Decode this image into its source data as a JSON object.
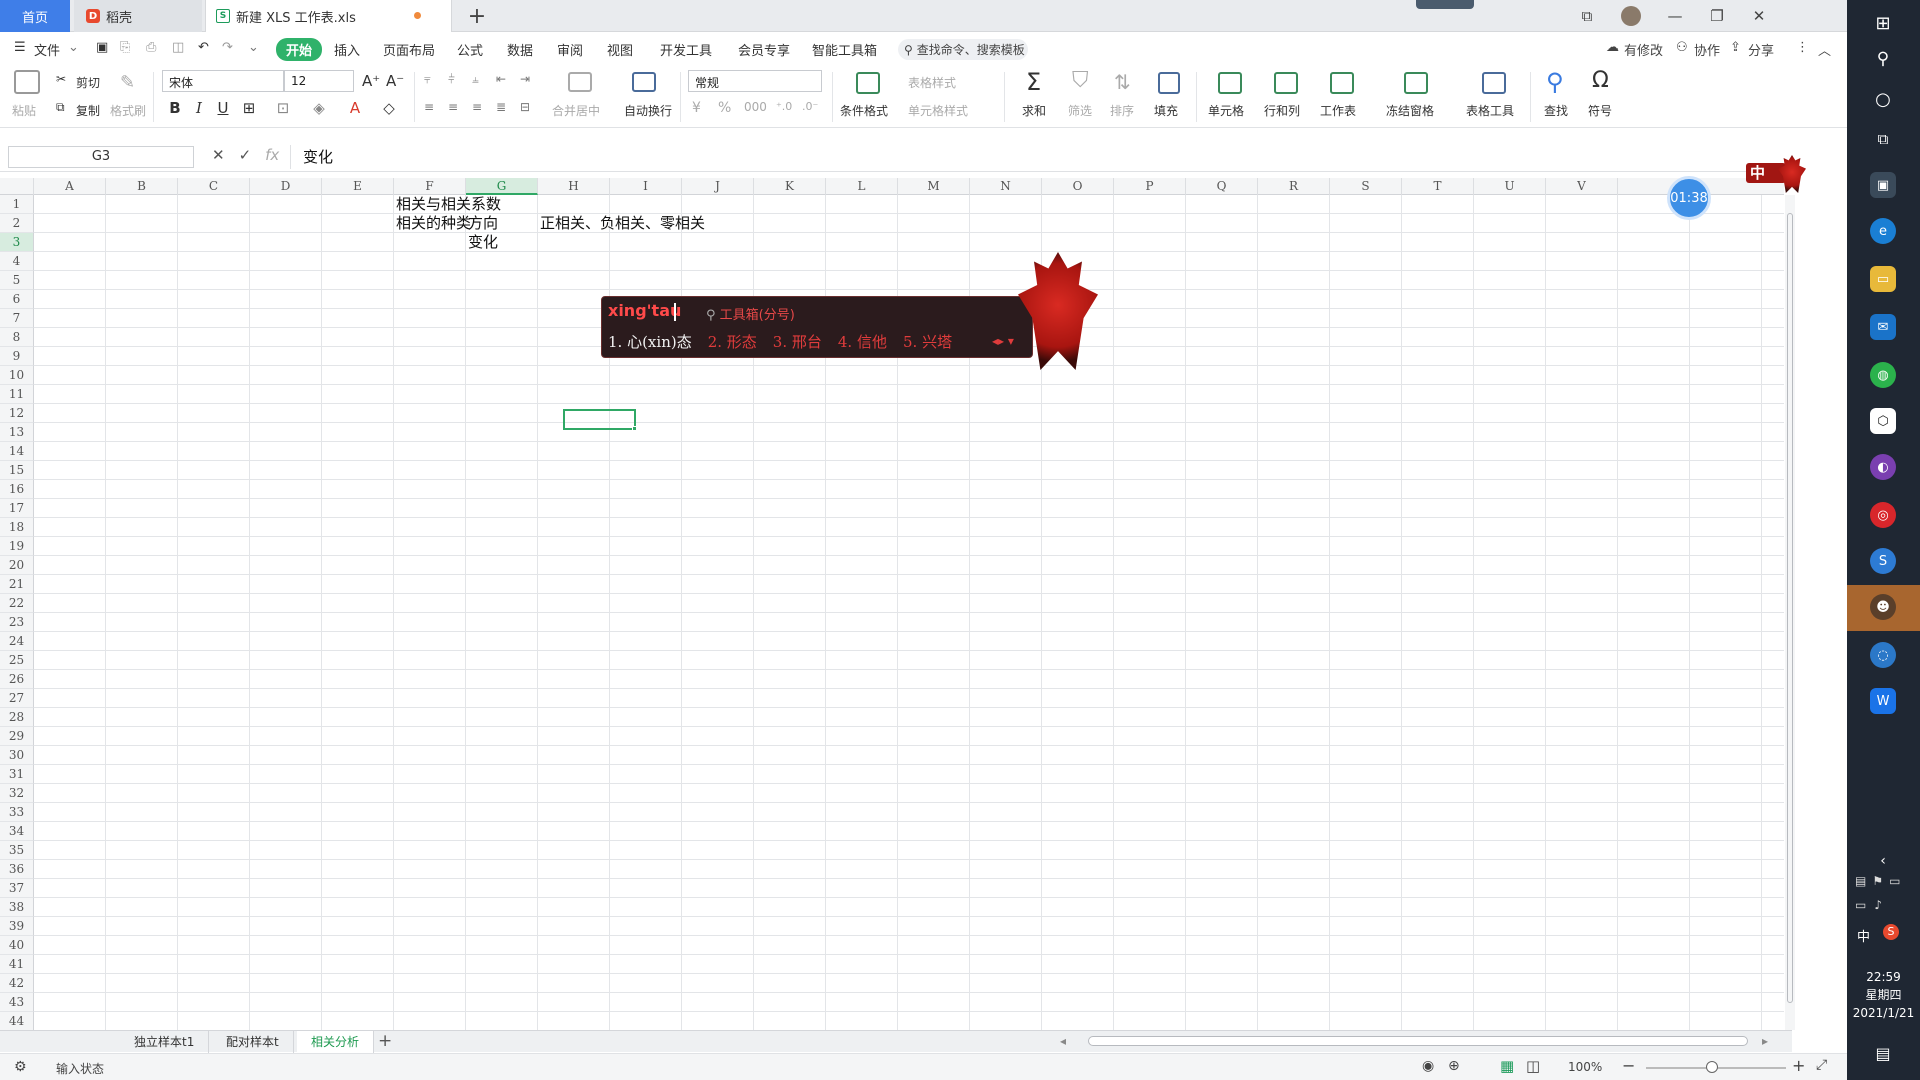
{
  "tabs": {
    "home": "首页",
    "docer": "稻壳",
    "doc_title": "新建 XLS 工作表.xls",
    "new_tab": "+"
  },
  "menu": {
    "file": "文件",
    "items": [
      "开始",
      "插入",
      "页面布局",
      "公式",
      "数据",
      "审阅",
      "视图",
      "开发工具",
      "会员专享",
      "智能工具箱"
    ],
    "search_placeholder": "查找命令、搜索模板",
    "has_changes": "有修改",
    "collaborate": "协作",
    "share": "分享"
  },
  "ribbon": {
    "paste": "粘贴",
    "cut": "剪切",
    "copy": "复制",
    "format_painter": "格式刷",
    "font_name": "宋体",
    "font_size": "12",
    "merge_center": "合并居中",
    "wrap_text": "自动换行",
    "number_format": "常规",
    "conditional_format": "条件格式",
    "table_style": "表格样式",
    "cell_style": "单元格样式",
    "sum": "求和",
    "filter": "筛选",
    "sort": "排序",
    "fill": "填充",
    "cells": "单元格",
    "rows_cols": "行和列",
    "worksheet": "工作表",
    "freeze": "冻结窗格",
    "table_tools": "表格工具",
    "find": "查找",
    "symbol": "符号"
  },
  "formula_bar": {
    "cell_ref": "G3",
    "content": "变化"
  },
  "columns": [
    "A",
    "B",
    "C",
    "D",
    "E",
    "F",
    "G",
    "H",
    "I",
    "J",
    "K",
    "L",
    "M",
    "N",
    "O",
    "P",
    "Q",
    "R",
    "S",
    "T",
    "U",
    "V"
  ],
  "selected_column": "G",
  "rows": [
    "1",
    "2",
    "3",
    "4",
    "5",
    "6",
    "7",
    "8",
    "9",
    "10",
    "11",
    "12",
    "13",
    "14",
    "15",
    "16",
    "17",
    "18",
    "19",
    "20",
    "21",
    "22",
    "23",
    "24",
    "25",
    "26",
    "27",
    "28",
    "29",
    "30",
    "31",
    "32",
    "33",
    "34",
    "35",
    "36",
    "37",
    "38",
    "39",
    "40",
    "41",
    "42",
    "43",
    "44"
  ],
  "selected_row": "3",
  "cells": {
    "F1": "相关与相关系数",
    "F2": "相关的种类",
    "G2": "方向",
    "H2": "正相关、负相关、零相关",
    "G3": "变化"
  },
  "sheets": [
    "独立样本t1",
    "配对样本t",
    "相关分析"
  ],
  "active_sheet": "相关分析",
  "status": {
    "mode": "输入状态",
    "zoom": "100%"
  },
  "ime": {
    "input": "xing'tau",
    "toolbox": "工具箱(分号)",
    "candidates": [
      "1. 心(xin)态",
      "2. 形态",
      "3. 邢台",
      "4. 信他",
      "5. 兴塔"
    ]
  },
  "timer": "01:38",
  "ime_badge": "中",
  "clock": {
    "time": "22:59",
    "weekday": "星期四",
    "date": "2021/1/21"
  },
  "taskbar_tray": {
    "ime_lang": "中"
  }
}
